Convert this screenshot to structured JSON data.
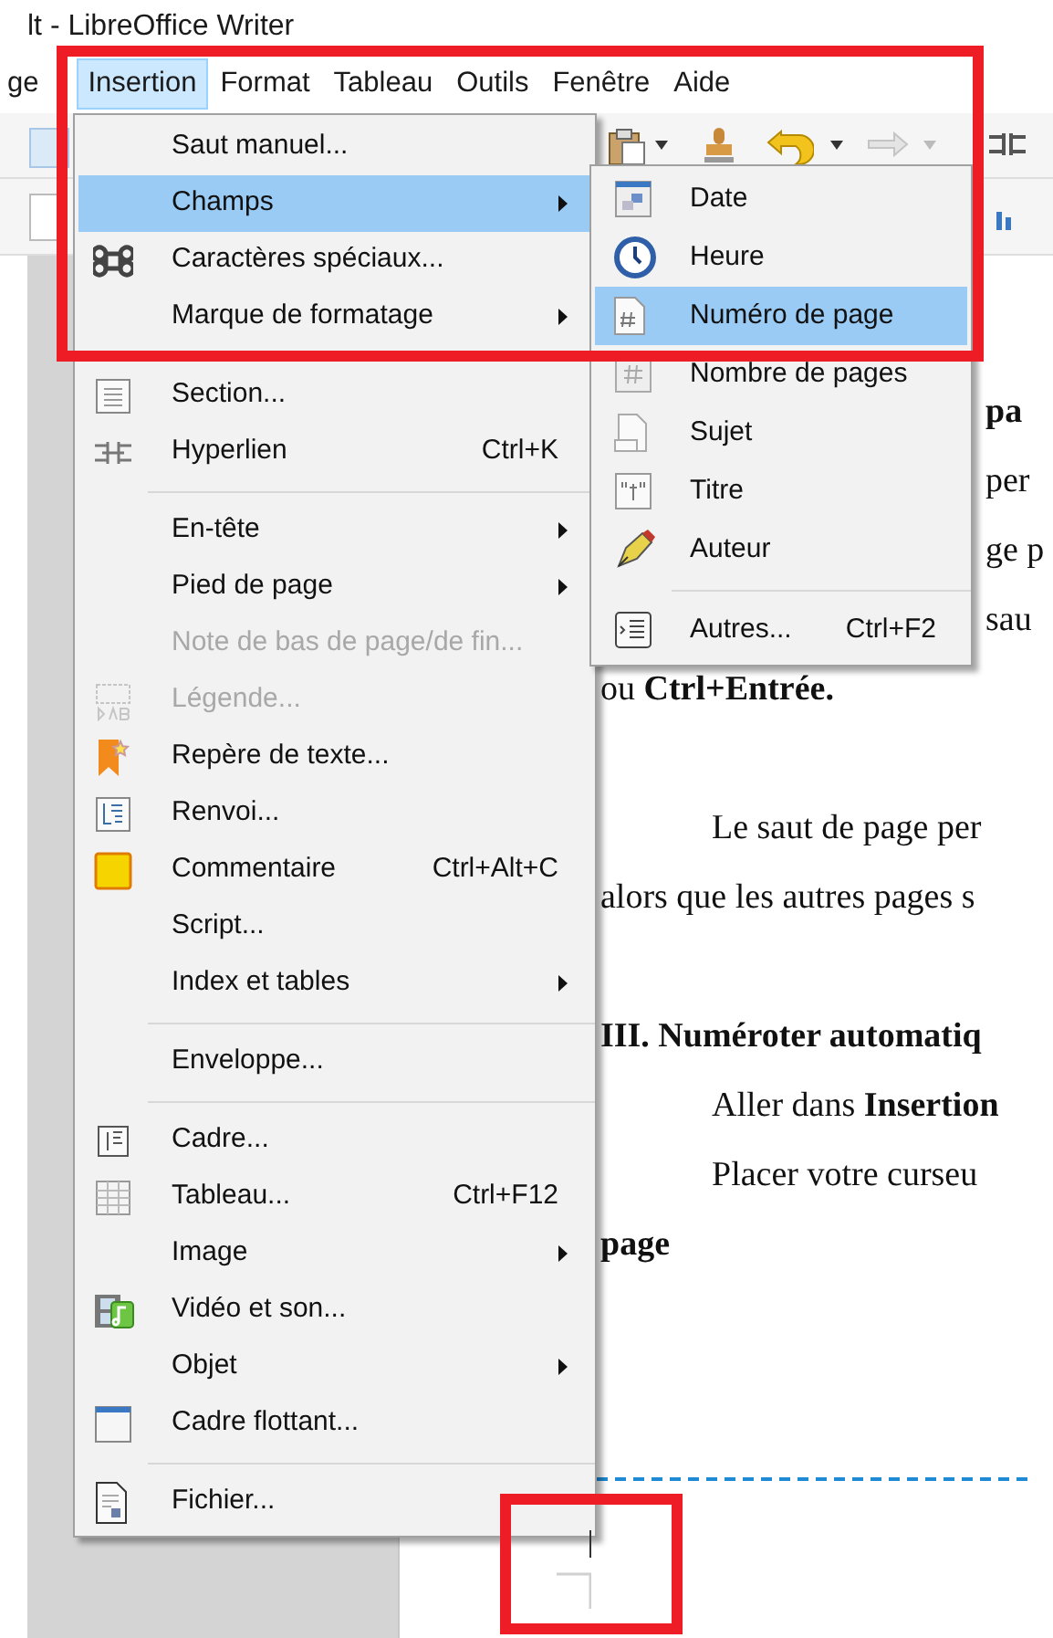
{
  "window": {
    "title": "lt - LibreOffice Writer"
  },
  "menu_bar": [
    {
      "label": "ge",
      "selected": false
    },
    {
      "label": "Insertion",
      "selected": true
    },
    {
      "label": "Format",
      "selected": false
    },
    {
      "label": "Tableau",
      "selected": false
    },
    {
      "label": "Outils",
      "selected": false
    },
    {
      "label": "Fenêtre",
      "selected": false
    },
    {
      "label": "Aide",
      "selected": false
    }
  ],
  "insert_menu": [
    {
      "kind": "item",
      "label": "Saut manuel...",
      "selected": false,
      "disabled": false,
      "submenu": false
    },
    {
      "kind": "item",
      "label": "Champs",
      "selected": true,
      "disabled": false,
      "submenu": true
    },
    {
      "kind": "item",
      "label": "Caractères spéciaux...",
      "selected": false,
      "disabled": false,
      "submenu": false
    },
    {
      "kind": "item",
      "label": "Marque de formatage",
      "selected": false,
      "disabled": false,
      "submenu": true
    },
    {
      "kind": "separator"
    },
    {
      "kind": "item",
      "label": "Section...",
      "selected": false,
      "disabled": false,
      "submenu": false
    },
    {
      "kind": "item",
      "label": "Hyperlien",
      "shortcut": "Ctrl+K",
      "selected": false,
      "disabled": false,
      "submenu": false
    },
    {
      "kind": "separator"
    },
    {
      "kind": "item",
      "label": "En-tête",
      "selected": false,
      "disabled": false,
      "submenu": true
    },
    {
      "kind": "item",
      "label": "Pied de page",
      "selected": false,
      "disabled": false,
      "submenu": true
    },
    {
      "kind": "item",
      "label": "Note de bas de page/de fin...",
      "selected": false,
      "disabled": true,
      "submenu": false
    },
    {
      "kind": "item",
      "label": "Légende...",
      "selected": false,
      "disabled": true,
      "submenu": false
    },
    {
      "kind": "item",
      "label": "Repère de texte...",
      "selected": false,
      "disabled": false,
      "submenu": false
    },
    {
      "kind": "item",
      "label": "Renvoi...",
      "selected": false,
      "disabled": false,
      "submenu": false
    },
    {
      "kind": "item",
      "label": "Commentaire",
      "shortcut": "Ctrl+Alt+C",
      "selected": false,
      "disabled": false,
      "submenu": false
    },
    {
      "kind": "item",
      "label": "Script...",
      "selected": false,
      "disabled": false,
      "submenu": false
    },
    {
      "kind": "item",
      "label": "Index et tables",
      "selected": false,
      "disabled": false,
      "submenu": true
    },
    {
      "kind": "separator"
    },
    {
      "kind": "item",
      "label": "Enveloppe...",
      "selected": false,
      "disabled": false,
      "submenu": false
    },
    {
      "kind": "separator"
    },
    {
      "kind": "item",
      "label": "Cadre...",
      "selected": false,
      "disabled": false,
      "submenu": false
    },
    {
      "kind": "item",
      "label": "Tableau...",
      "shortcut": "Ctrl+F12",
      "selected": false,
      "disabled": false,
      "submenu": false
    },
    {
      "kind": "item",
      "label": "Image",
      "selected": false,
      "disabled": false,
      "submenu": true
    },
    {
      "kind": "item",
      "label": "Vidéo et son...",
      "selected": false,
      "disabled": false,
      "submenu": false
    },
    {
      "kind": "item",
      "label": "Objet",
      "selected": false,
      "disabled": false,
      "submenu": true
    },
    {
      "kind": "item",
      "label": "Cadre flottant...",
      "selected": false,
      "disabled": false,
      "submenu": false
    },
    {
      "kind": "separator"
    },
    {
      "kind": "item",
      "label": "Fichier...",
      "selected": false,
      "disabled": false,
      "submenu": false
    }
  ],
  "fields_submenu": [
    {
      "kind": "item",
      "label": "Date",
      "selected": false
    },
    {
      "kind": "item",
      "label": "Heure",
      "selected": false
    },
    {
      "kind": "item",
      "label": "Numéro de page",
      "selected": true
    },
    {
      "kind": "item",
      "label": "Nombre de pages",
      "selected": false
    },
    {
      "kind": "item",
      "label": "Sujet",
      "selected": false
    },
    {
      "kind": "item",
      "label": "Titre",
      "selected": false
    },
    {
      "kind": "item",
      "label": "Auteur",
      "selected": false
    },
    {
      "kind": "separator"
    },
    {
      "kind": "item",
      "label": "Autres...",
      "shortcut": "Ctrl+F2",
      "selected": false
    }
  ],
  "document": [
    {
      "lines": [
        {
          "kind": "tail",
          "text": "pa",
          "bold": true
        },
        {
          "kind": "tail",
          "text": "per",
          "bold": false
        },
        {
          "kind": "tail",
          "text": "ge p",
          "bold": false
        },
        {
          "kind": "tail",
          "text": "sau",
          "bold": false
        },
        {
          "kind": "line",
          "text": "ou **Ctrl+Entrée.**",
          "bold": false
        }
      ]
    },
    {
      "lines": [
        {
          "kind": "indented",
          "text": "Le saut de page per",
          "bold": false
        },
        {
          "kind": "line",
          "text": "alors que les autres pages s",
          "bold": false
        }
      ]
    },
    {
      "lines": [
        {
          "kind": "line",
          "text": "III. Numéroter automatiq",
          "bold": true
        },
        {
          "kind": "indented",
          "text": "Aller dans **Insertion**",
          "bold": false
        },
        {
          "kind": "indented",
          "text": "Placer votre curseu",
          "bold": false
        },
        {
          "kind": "line",
          "text": "page",
          "bold": true
        }
      ]
    }
  ]
}
